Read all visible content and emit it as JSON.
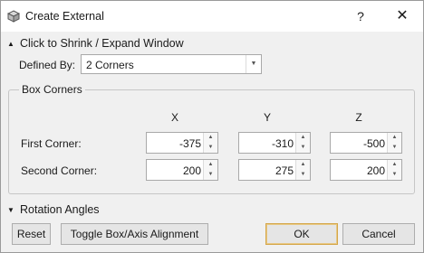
{
  "window": {
    "title": "Create External",
    "help_glyph": "?",
    "close_glyph": "✕"
  },
  "shrink_section": {
    "label": "Click to Shrink / Expand Window",
    "expanded": true
  },
  "defined_by": {
    "label": "Defined By:",
    "value": "2 Corners"
  },
  "box_corners": {
    "label": "Box Corners",
    "columns": [
      "X",
      "Y",
      "Z"
    ],
    "rows": [
      {
        "label": "First Corner:",
        "values": [
          "-375",
          "-310",
          "-500"
        ]
      },
      {
        "label": "Second Corner:",
        "values": [
          "200",
          "275",
          "200"
        ]
      }
    ]
  },
  "rotation_section": {
    "label": "Rotation Angles",
    "expanded": false
  },
  "buttons": {
    "reset": "Reset",
    "toggle": "Toggle Box/Axis Alignment",
    "ok": "OK",
    "cancel": "Cancel"
  },
  "icons": {
    "app": "external-box-icon",
    "help": "help-icon",
    "close": "close-icon"
  },
  "colors": {
    "default_button_border": "#d4a64a"
  }
}
